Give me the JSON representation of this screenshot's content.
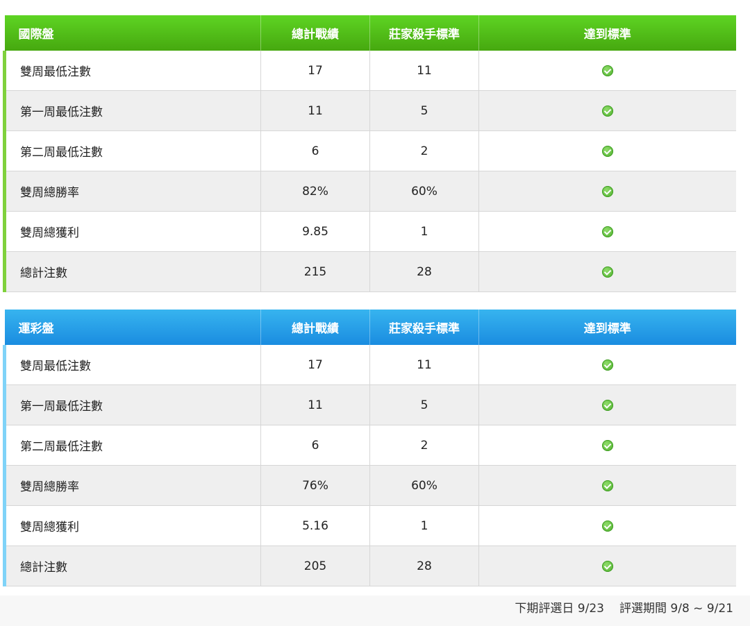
{
  "tables": [
    {
      "header": [
        "國際盤",
        "總計戰績",
        "莊家殺手標準",
        "達到標準"
      ],
      "rows": [
        {
          "label": "雙周最低注數",
          "total": "17",
          "standard": "11"
        },
        {
          "label": "第一周最低注數",
          "total": "11",
          "standard": "5"
        },
        {
          "label": "第二周最低注數",
          "total": "6",
          "standard": "2"
        },
        {
          "label": "雙周總勝率",
          "total": "82%",
          "standard": "60%"
        },
        {
          "label": "雙周總獲利",
          "total": "9.85",
          "standard": "1"
        },
        {
          "label": "總計注數",
          "total": "215",
          "standard": "28"
        }
      ]
    },
    {
      "header": [
        "運彩盤",
        "總計戰績",
        "莊家殺手標準",
        "達到標準"
      ],
      "rows": [
        {
          "label": "雙周最低注數",
          "total": "17",
          "standard": "11"
        },
        {
          "label": "第一周最低注數",
          "total": "11",
          "standard": "5"
        },
        {
          "label": "第二周最低注數",
          "total": "6",
          "standard": "2"
        },
        {
          "label": "雙周總勝率",
          "total": "76%",
          "standard": "60%"
        },
        {
          "label": "雙周總獲利",
          "total": "5.16",
          "standard": "1"
        },
        {
          "label": "總計注數",
          "total": "205",
          "standard": "28"
        }
      ]
    }
  ],
  "footer": {
    "next_selection": "下期評選日 9/23",
    "period": "評選期間 9/8 ~ 9/21"
  },
  "icons": {
    "status": "check-circle-icon",
    "accent_intl": "#4fb716",
    "accent_sport": "#2aa0ea"
  }
}
